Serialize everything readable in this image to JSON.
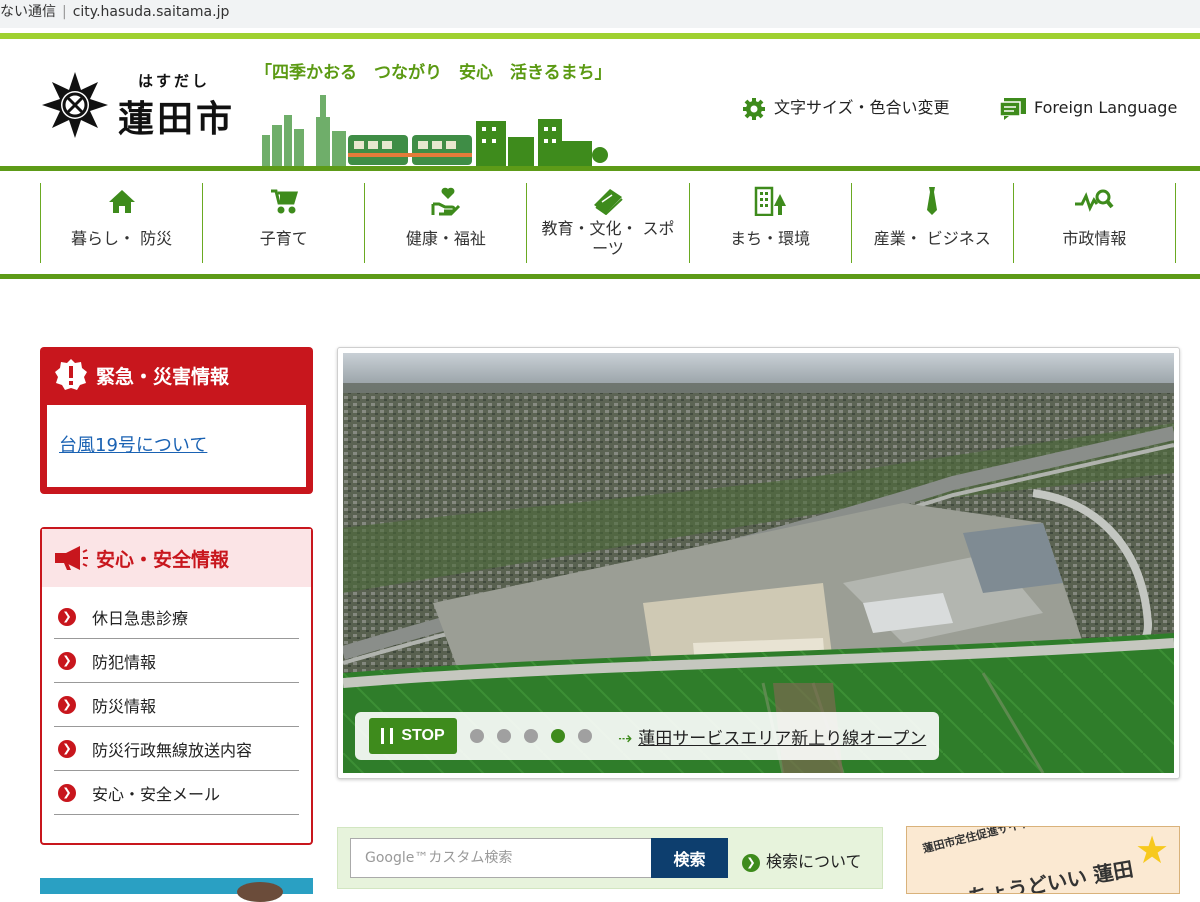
{
  "browser": {
    "security_text": "ない通信",
    "url": "city.hasuda.saitama.jp"
  },
  "header": {
    "logo_ruby": "はすだし",
    "logo_name": "蓮田市",
    "slogan": "「四季かおる　つながり　安心　活きるまち」",
    "util_text_size": "文字サイズ・色合い変更",
    "util_language": "Foreign Language"
  },
  "nav": {
    "items": [
      {
        "label": "暮らし・ 防災",
        "icon": "house-icon"
      },
      {
        "label": "子育て",
        "icon": "stroller-icon"
      },
      {
        "label": "健康・福祉",
        "icon": "heart-hand-icon"
      },
      {
        "label": "教育・文化・ スポーツ",
        "icon": "book-icon"
      },
      {
        "label": "まち・環境",
        "icon": "building-tree-icon"
      },
      {
        "label": "産業・ ビジネス",
        "icon": "necktie-icon"
      },
      {
        "label": "市政情報",
        "icon": "graph-magnifier-icon"
      }
    ]
  },
  "emergency": {
    "title": "緊急・災害情報",
    "link": "台風19号について"
  },
  "safety": {
    "title": "安心・安全情報",
    "items": [
      "休日急患診療",
      "防犯情報",
      "防災情報",
      "防災行政無線放送内容",
      "安心・安全メール"
    ]
  },
  "slider": {
    "stop_label": "STOP",
    "dots": 5,
    "active_dot": 4,
    "caption": "蓮田サービスエリア新上り線オープン"
  },
  "search": {
    "placeholder": "Google™カスタム検索",
    "button": "検索",
    "help": "検索について"
  },
  "banner": {
    "small_text": "蓮田市定住促進サイト",
    "big_text": "ちょうどいい 蓮田"
  },
  "colors": {
    "brand_green": "#5d9b18",
    "light_green": "#9fd130",
    "alert_red": "#c8161d",
    "search_blue": "#0d3e6e"
  }
}
